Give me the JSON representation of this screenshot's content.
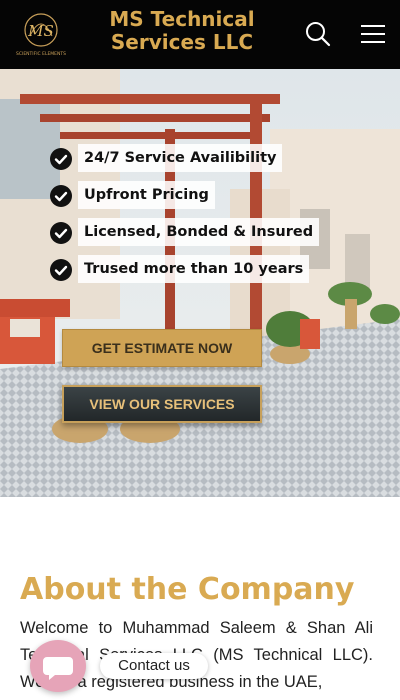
{
  "header": {
    "brand_line1": "MS Technical",
    "brand_line2": "Services LLC",
    "logo_monogram": "MS",
    "logo_caption": "SCIENTIFIC ELEMENTS",
    "search_icon": "search-icon",
    "menu_icon": "hamburger-menu-icon"
  },
  "hero": {
    "features": [
      {
        "text": "24/7 Service Availibility",
        "icon": "check-circle-icon"
      },
      {
        "text": "Upfront Pricing",
        "icon": "check-circle-icon"
      },
      {
        "text": "Licensed, Bonded & Insured",
        "icon": "check-circle-icon"
      },
      {
        "text": "Trused more than 10 years",
        "icon": "check-circle-icon"
      }
    ],
    "estimate_button": "GET ESTIMATE NOW",
    "services_button": "VIEW OUR SERVICES"
  },
  "about": {
    "title": "About the Company",
    "text": "Welcome to Muhammad Saleem & Shan Ali Technical Services LLC (MS Technical LLC). We are a registered business in the UAE,"
  },
  "contact": {
    "label": "Contact us",
    "icon": "chat-bubble-icon"
  },
  "colors": {
    "header_bg": "#050505",
    "brand_gold": "#d9aa52",
    "estimate_bg": "#cfa355",
    "services_bg": "#2c3234",
    "contact_fab": "#e6a4b8"
  }
}
